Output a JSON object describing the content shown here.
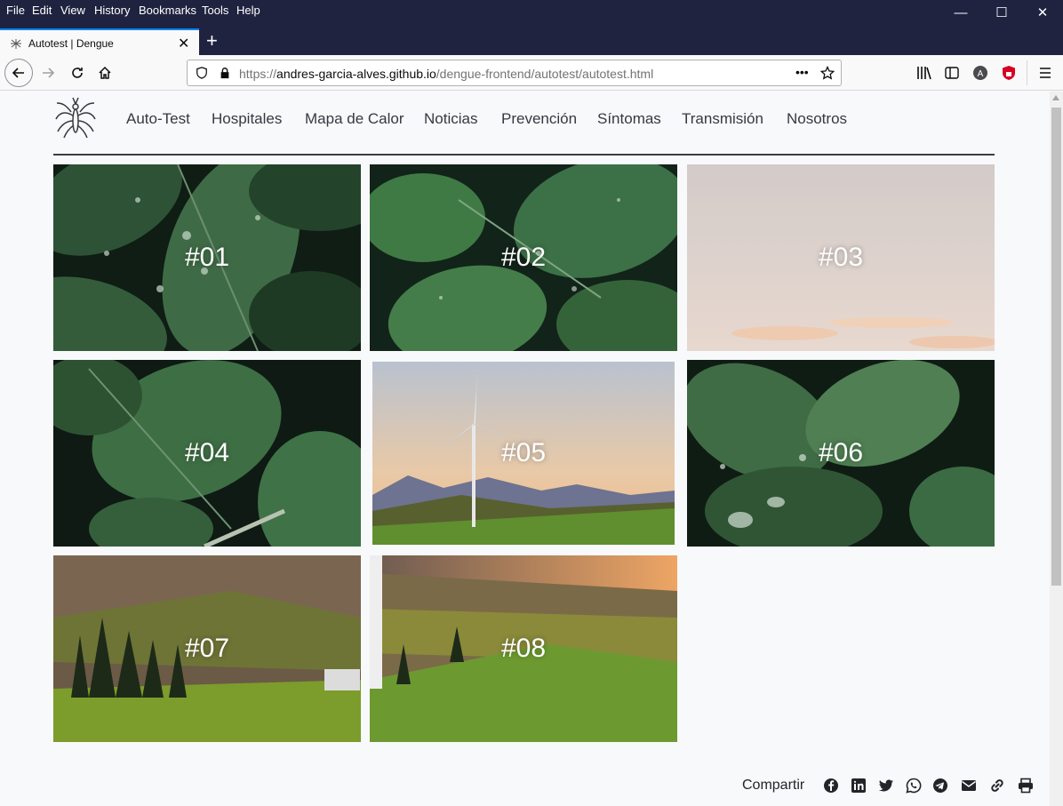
{
  "menu": [
    "File",
    "Edit",
    "View",
    "History",
    "Bookmarks",
    "Tools",
    "Help"
  ],
  "window_controls": {
    "minimize": "—",
    "maximize": "☐",
    "close": "✕"
  },
  "tab": {
    "title": "Autotest | Dengue",
    "close": "✕",
    "new_tab": "+"
  },
  "url": {
    "prefix": "https://",
    "host": "andres-garcia-alves.github.io",
    "path": "/dengue-frontend/autotest/autotest.html",
    "more": "•••"
  },
  "site": {
    "nav": [
      "Auto-Test",
      "Hospitales",
      "Mapa de Calor",
      "Noticias",
      "Prevención",
      "Síntomas",
      "Transmisión",
      "Nosotros"
    ],
    "tiles": [
      "#01",
      "#02",
      "#03",
      "#04",
      "#05",
      "#06",
      "#07",
      "#08"
    ],
    "share_label": "Compartir",
    "share_icons": [
      "facebook-icon",
      "linkedin-icon",
      "twitter-icon",
      "whatsapp-icon",
      "telegram-icon",
      "email-icon",
      "link-icon",
      "print-icon"
    ]
  },
  "colors": {
    "titlebar": "#202340",
    "accent": "#0a84ff",
    "leaf_dark": "#1f3a24",
    "leaf_green": "#3d6b3f",
    "sky": "#d9cdc8"
  }
}
